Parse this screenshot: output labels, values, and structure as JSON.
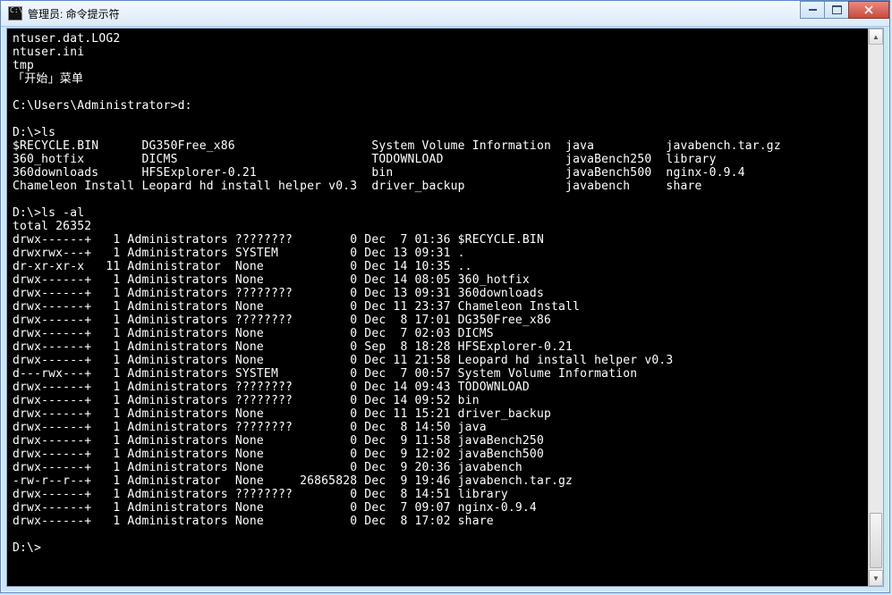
{
  "window": {
    "icon_text": "C:\\",
    "title": "管理员: 命令提示符"
  },
  "terminal": {
    "pre_lines": [
      "ntuser.dat.LOG2",
      "ntuser.ini",
      "tmp",
      "「开始」菜单",
      "",
      "C:\\Users\\Administrator>d:",
      "",
      "D:\\>ls"
    ],
    "ls_cols": [
      [
        "$RECYCLE.BIN",
        "360_hotfix",
        "360downloads",
        "Chameleon Install"
      ],
      [
        "DG350Free_x86",
        "DICMS",
        "HFSExplorer-0.21",
        "Leopard hd install helper v0.3"
      ],
      [
        "System Volume Information",
        "TODOWNLOAD",
        "bin",
        "driver_backup"
      ],
      [
        "java",
        "javaBench250",
        "javaBench500",
        "javabench"
      ],
      [
        "javabench.tar.gz",
        "library",
        "nginx-0.9.4",
        "share"
      ]
    ],
    "ls_col_widths": [
      18,
      32,
      27,
      14,
      0
    ],
    "mid_lines": [
      "",
      "D:\\>ls -al",
      "total 26352"
    ],
    "detail_rows": [
      {
        "perm": "drwx------+",
        "ln": "1",
        "user": "Administrators",
        "grp": "????????",
        "size": "0",
        "mon": "Dec",
        "day": "7",
        "time": "01:36",
        "name": "$RECYCLE.BIN"
      },
      {
        "perm": "drwxrwx---+",
        "ln": "1",
        "user": "Administrators",
        "grp": "SYSTEM",
        "size": "0",
        "mon": "Dec",
        "day": "13",
        "time": "09:31",
        "name": "."
      },
      {
        "perm": "dr-xr-xr-x",
        "ln": "11",
        "user": "Administrator",
        "grp": "None",
        "size": "0",
        "mon": "Dec",
        "day": "14",
        "time": "10:35",
        "name": ".."
      },
      {
        "perm": "drwx------+",
        "ln": "1",
        "user": "Administrators",
        "grp": "None",
        "size": "0",
        "mon": "Dec",
        "day": "14",
        "time": "08:05",
        "name": "360_hotfix"
      },
      {
        "perm": "drwx------+",
        "ln": "1",
        "user": "Administrators",
        "grp": "????????",
        "size": "0",
        "mon": "Dec",
        "day": "13",
        "time": "09:31",
        "name": "360downloads"
      },
      {
        "perm": "drwx------+",
        "ln": "1",
        "user": "Administrators",
        "grp": "None",
        "size": "0",
        "mon": "Dec",
        "day": "11",
        "time": "23:37",
        "name": "Chameleon Install"
      },
      {
        "perm": "drwx------+",
        "ln": "1",
        "user": "Administrators",
        "grp": "????????",
        "size": "0",
        "mon": "Dec",
        "day": "8",
        "time": "17:01",
        "name": "DG350Free_x86"
      },
      {
        "perm": "drwx------+",
        "ln": "1",
        "user": "Administrators",
        "grp": "None",
        "size": "0",
        "mon": "Dec",
        "day": "7",
        "time": "02:03",
        "name": "DICMS"
      },
      {
        "perm": "drwx------+",
        "ln": "1",
        "user": "Administrators",
        "grp": "None",
        "size": "0",
        "mon": "Sep",
        "day": "8",
        "time": "18:28",
        "name": "HFSExplorer-0.21"
      },
      {
        "perm": "drwx------+",
        "ln": "1",
        "user": "Administrators",
        "grp": "None",
        "size": "0",
        "mon": "Dec",
        "day": "11",
        "time": "21:58",
        "name": "Leopard hd install helper v0.3"
      },
      {
        "perm": "d---rwx---+",
        "ln": "1",
        "user": "Administrators",
        "grp": "SYSTEM",
        "size": "0",
        "mon": "Dec",
        "day": "7",
        "time": "00:57",
        "name": "System Volume Information"
      },
      {
        "perm": "drwx------+",
        "ln": "1",
        "user": "Administrators",
        "grp": "????????",
        "size": "0",
        "mon": "Dec",
        "day": "14",
        "time": "09:43",
        "name": "TODOWNLOAD"
      },
      {
        "perm": "drwx------+",
        "ln": "1",
        "user": "Administrators",
        "grp": "????????",
        "size": "0",
        "mon": "Dec",
        "day": "14",
        "time": "09:52",
        "name": "bin"
      },
      {
        "perm": "drwx------+",
        "ln": "1",
        "user": "Administrators",
        "grp": "None",
        "size": "0",
        "mon": "Dec",
        "day": "11",
        "time": "15:21",
        "name": "driver_backup"
      },
      {
        "perm": "drwx------+",
        "ln": "1",
        "user": "Administrators",
        "grp": "????????",
        "size": "0",
        "mon": "Dec",
        "day": "8",
        "time": "14:50",
        "name": "java"
      },
      {
        "perm": "drwx------+",
        "ln": "1",
        "user": "Administrators",
        "grp": "None",
        "size": "0",
        "mon": "Dec",
        "day": "9",
        "time": "11:58",
        "name": "javaBench250"
      },
      {
        "perm": "drwx------+",
        "ln": "1",
        "user": "Administrators",
        "grp": "None",
        "size": "0",
        "mon": "Dec",
        "day": "9",
        "time": "12:02",
        "name": "javaBench500"
      },
      {
        "perm": "drwx------+",
        "ln": "1",
        "user": "Administrators",
        "grp": "None",
        "size": "0",
        "mon": "Dec",
        "day": "9",
        "time": "20:36",
        "name": "javabench"
      },
      {
        "perm": "-rw-r--r--+",
        "ln": "1",
        "user": "Administrator",
        "grp": "None",
        "size": "26865828",
        "mon": "Dec",
        "day": "9",
        "time": "19:46",
        "name": "javabench.tar.gz"
      },
      {
        "perm": "drwx------+",
        "ln": "1",
        "user": "Administrators",
        "grp": "????????",
        "size": "0",
        "mon": "Dec",
        "day": "8",
        "time": "14:51",
        "name": "library"
      },
      {
        "perm": "drwx------+",
        "ln": "1",
        "user": "Administrators",
        "grp": "None",
        "size": "0",
        "mon": "Dec",
        "day": "7",
        "time": "09:07",
        "name": "nginx-0.9.4"
      },
      {
        "perm": "drwx------+",
        "ln": "1",
        "user": "Administrators",
        "grp": "None",
        "size": "0",
        "mon": "Dec",
        "day": "8",
        "time": "17:02",
        "name": "share"
      }
    ],
    "final_prompt": "D:\\>"
  }
}
